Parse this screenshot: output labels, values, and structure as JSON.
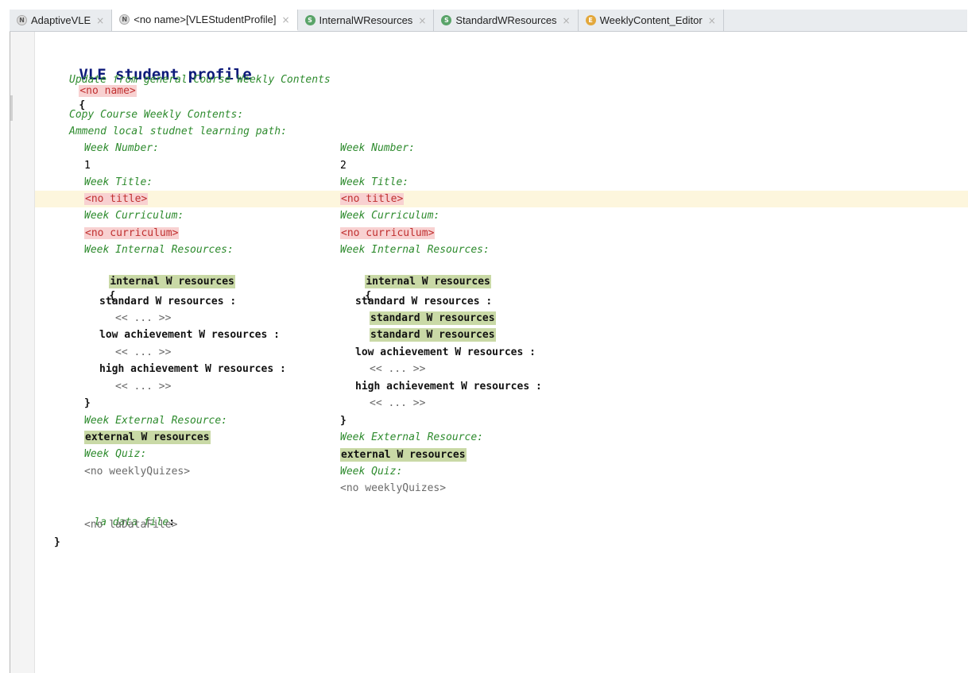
{
  "tabs": [
    {
      "badge": "N",
      "label": "AdaptiveVLE",
      "close": "×"
    },
    {
      "badge": "N",
      "label": "<no name>[VLEStudentProfile]",
      "close": "×"
    },
    {
      "badge": "S",
      "label": "InternalWResources",
      "close": "×"
    },
    {
      "badge": "S",
      "label": "StandardWResources",
      "close": "×"
    },
    {
      "badge": "E",
      "label": "WeeklyContent_Editor",
      "close": "×"
    }
  ],
  "editor": {
    "concept": "VLE student profile",
    "name": "<no name>",
    "open_brace": "{",
    "update_line": "Update from general Course Weekly Contents",
    "copy_line": "Copy Course Weekly Contents:",
    "ammend_line": "Ammend local studnet learning path:",
    "la_label": "la data file",
    "la_colon": ":",
    "la_value": "<no laDataFile>",
    "close_brace": "}",
    "weeks": [
      {
        "number_label": "Week Number:",
        "number": "1",
        "title_label": "Week Title:",
        "title": "<no title>",
        "curriculum_label": "Week Curriculum:",
        "curriculum": "<no curriculum>",
        "internal_label": "Week Internal Resources:",
        "internal_ref": "internal W resources",
        "internal_open": "{",
        "standard_label": "standard W resources :",
        "standard_items": [],
        "standard_empty": "<< ... >>",
        "low_label": "low achievement W resources :",
        "low_empty": "<< ... >>",
        "high_label": "high achievement W resources :",
        "high_empty": "<< ... >>",
        "internal_close": "}",
        "external_label": "Week External Resource:",
        "external_ref": "external W resources",
        "quiz_label": "Week Quiz:",
        "quiz": "<no weeklyQuizes>"
      },
      {
        "number_label": "Week Number:",
        "number": "2",
        "title_label": "Week Title:",
        "title": "<no title>",
        "curriculum_label": "Week Curriculum:",
        "curriculum": "<no curriculum>",
        "internal_label": "Week Internal Resources:",
        "internal_ref": "internal W resources",
        "internal_open": "{",
        "standard_label": "standard W resources :",
        "standard_items": [
          "standard W resources",
          "standard W resources"
        ],
        "low_label": "low achievement W resources :",
        "low_empty": "<< ... >>",
        "high_label": "high achievement W resources :",
        "high_empty": "<< ... >>",
        "internal_close": "}",
        "external_label": "Week External Resource:",
        "external_ref": "external W resources",
        "quiz_label": "Week Quiz:",
        "quiz": "<no weeklyQuizes>"
      }
    ]
  },
  "colors": {
    "accent_title": "#0d1a7a",
    "comment": "#2e8b2e",
    "error_bg": "#f8d1d1",
    "error_fg": "#c03030",
    "ref_highlight": "#c9d9a6",
    "caret_line": "#fdf6dd"
  }
}
